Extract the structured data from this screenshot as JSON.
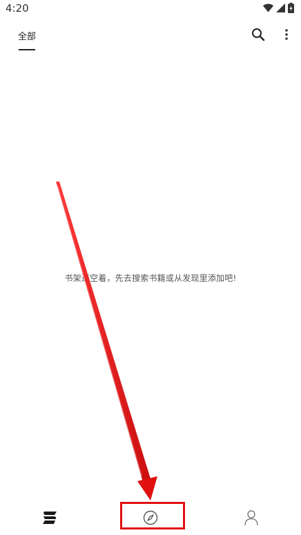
{
  "status_bar": {
    "time": "4:20",
    "icons": [
      "wifi-icon",
      "signal-icon",
      "battery-icon"
    ]
  },
  "header": {
    "tabs": [
      {
        "label": "全部",
        "selected": true
      }
    ],
    "actions": [
      "search-icon",
      "more-vert-icon"
    ]
  },
  "bookshelf": {
    "empty_message": "书架还空着，先去搜索书籍或从发现里添加吧!"
  },
  "bottom_nav": {
    "items": [
      {
        "name": "bookshelf",
        "icon": "bookshelf-icon"
      },
      {
        "name": "discover",
        "icon": "compass-icon",
        "highlighted": true
      },
      {
        "name": "mine",
        "icon": "person-icon"
      }
    ]
  },
  "colors": {
    "annotation": "#e01010",
    "text_primary": "#222222",
    "text_secondary": "#555555",
    "background": "#ffffff"
  }
}
